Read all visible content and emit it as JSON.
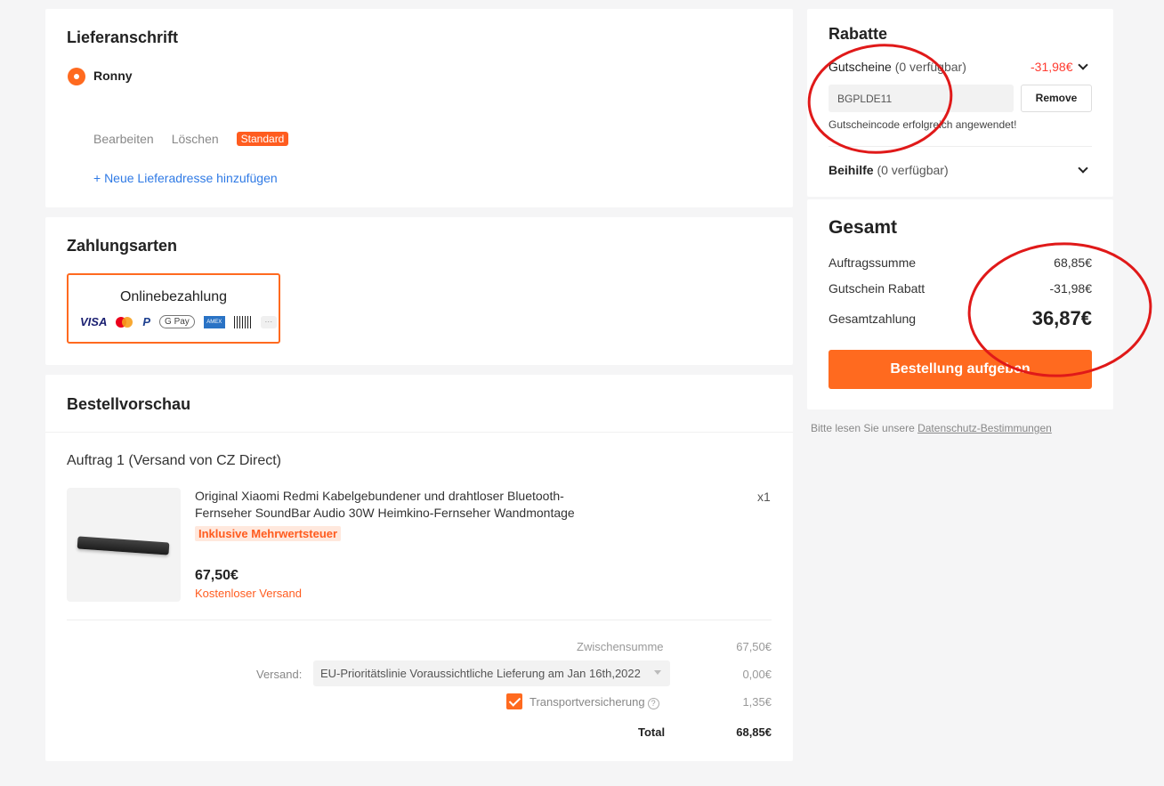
{
  "address": {
    "title": "Lieferanschrift",
    "name": "Ronny",
    "edit": "Bearbeiten",
    "delete": "Löschen",
    "default_badge": "Standard",
    "add_new": "+ Neue Lieferadresse hinzufügen"
  },
  "payment": {
    "title": "Zahlungsarten",
    "method": "Onlinebezahlung",
    "icons": [
      "VISA",
      "mastercard-icon",
      "P",
      "G Pay",
      "AMEX",
      "barcode-icon",
      "···"
    ]
  },
  "preview": {
    "title": "Bestellvorschau",
    "order_title": "Auftrag 1 (Versand von CZ Direct)",
    "product": {
      "name": "Original Xiaomi Redmi Kabelgebundener und drahtloser Bluetooth-Fernseher SoundBar Audio 30W Heimkino-Fernseher Wandmontage",
      "qty": "x1",
      "vat_badge": "Inklusive Mehrwertsteuer",
      "price": "67,50€",
      "shipping": "Kostenloser Versand"
    },
    "summary": {
      "subtotal_label": "Zwischensumme",
      "subtotal_value": "67,50€",
      "shipping_label": "Versand:",
      "shipping_option": "EU-Prioritätslinie Voraussichtliche Lieferung am Jan 16th,2022",
      "shipping_value": "0,00€",
      "insurance_label": "Transportversicherung",
      "insurance_value": "1,35€",
      "total_label": "Total",
      "total_value": "68,85€"
    }
  },
  "discounts": {
    "title": "Rabatte",
    "coupon_label": "Gutscheine",
    "coupon_available": "(0 verfügbar)",
    "coupon_value": "-31,98€",
    "coupon_code": "BGPLDE11",
    "remove": "Remove",
    "coupon_success": "Gutscheincode erfolgreich angewendet!",
    "allowance_label": "Beihilfe",
    "allowance_available": "(0 verfügbar)"
  },
  "total": {
    "title": "Gesamt",
    "order_sum_label": "Auftragssumme",
    "order_sum_value": "68,85€",
    "coupon_discount_label": "Gutschein Rabatt",
    "coupon_discount_value": "-31,98€",
    "grand_total_label": "Gesamtzahlung",
    "grand_total_value": "36,87€",
    "place_order": "Bestellung aufgeben"
  },
  "privacy": {
    "prefix": "Bitte lesen Sie unsere",
    "link": "Datenschutz-Bestimmungen"
  },
  "colors": {
    "accent": "#ff6a1f",
    "discount_red": "#ff3b30",
    "annotation_red": "#e01919"
  }
}
